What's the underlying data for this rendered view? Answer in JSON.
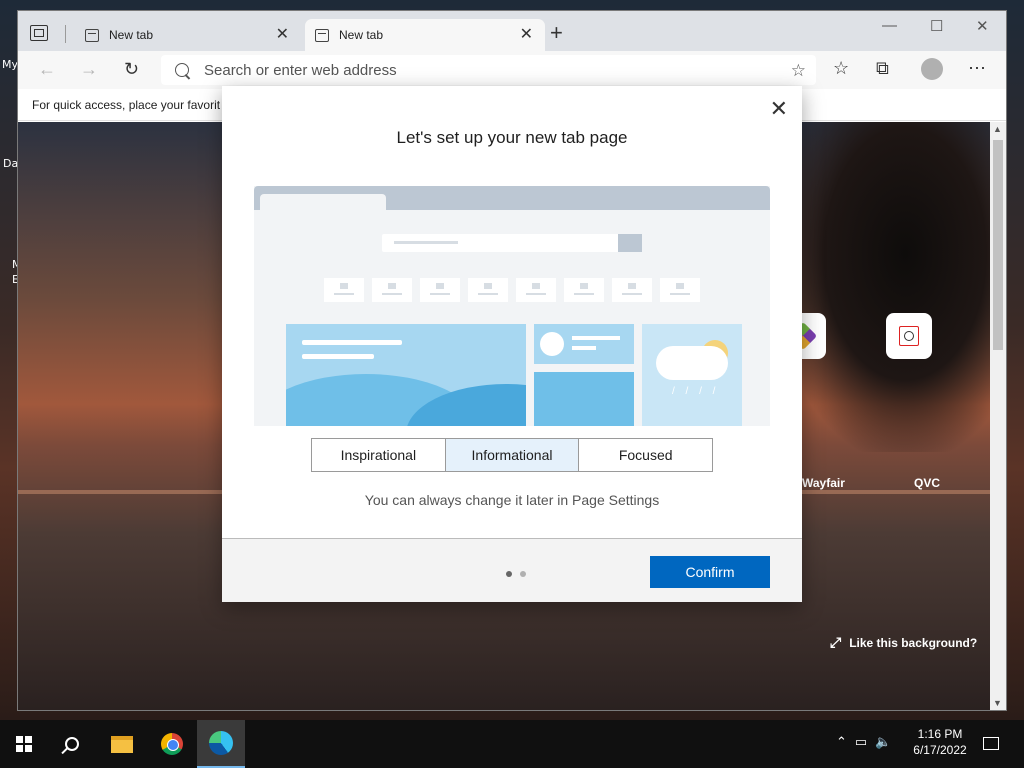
{
  "desktop": {
    "fragments": [
      "My",
      "Da",
      "M",
      "E"
    ]
  },
  "browser": {
    "tabs": [
      {
        "label": "New tab",
        "active": false
      },
      {
        "label": "New tab",
        "active": true
      }
    ],
    "address_placeholder": "Search or enter web address",
    "favbar_text": "For quick access, place your favorit"
  },
  "page": {
    "quick_links": [
      {
        "label": "Wayfair",
        "icon": "wayfair-icon"
      },
      {
        "label": "QVC",
        "icon": "qvc-icon"
      }
    ],
    "like_background": "Like this background?"
  },
  "dialog": {
    "title": "Let's set up your new tab page",
    "options": [
      {
        "label": "Inspirational",
        "selected": false
      },
      {
        "label": "Informational",
        "selected": true
      },
      {
        "label": "Focused",
        "selected": false
      }
    ],
    "hint": "You can always change it later in Page Settings",
    "pager": {
      "current": 1,
      "total": 2
    },
    "confirm_label": "Confirm"
  },
  "taskbar": {
    "time": "1:16 PM",
    "date": "6/17/2022",
    "apps": [
      "start-icon",
      "search-icon",
      "file-explorer-icon",
      "chrome-icon",
      "edge-icon"
    ]
  },
  "colors": {
    "accent": "#0067c0",
    "selected_option": "#e5f1fb"
  }
}
